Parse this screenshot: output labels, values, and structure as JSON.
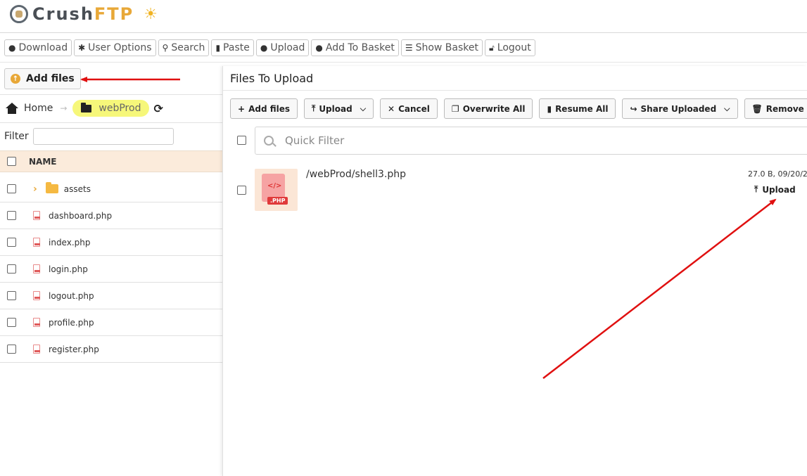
{
  "header": {
    "logo_crush": "Crush",
    "logo_ftp": "FTP",
    "logo_icon": "crushftp-logo-icon",
    "theme_icon": "sun-icon"
  },
  "toolbar": {
    "items": [
      {
        "label": "Download",
        "icon": "download-circle-icon"
      },
      {
        "label": "User Options",
        "icon": "gear-icon"
      },
      {
        "label": "Search",
        "icon": "search-icon"
      },
      {
        "label": "Paste",
        "icon": "paste-icon"
      },
      {
        "label": "Upload",
        "icon": "upload-circle-icon"
      },
      {
        "label": "Add To Basket",
        "icon": "plus-circle-icon"
      },
      {
        "label": "Show Basket",
        "icon": "list-icon"
      },
      {
        "label": "Logout",
        "icon": "lock-icon"
      }
    ]
  },
  "left": {
    "add_files_label": "Add files",
    "breadcrumb_home": "Home",
    "breadcrumb_current": "webProd",
    "filter_label": "Filter",
    "filter_value": "",
    "name_header": "NAME",
    "files": [
      {
        "name": "assets",
        "type": "folder"
      },
      {
        "name": "dashboard.php",
        "type": "file"
      },
      {
        "name": "index.php",
        "type": "file"
      },
      {
        "name": "login.php",
        "type": "file"
      },
      {
        "name": "logout.php",
        "type": "file"
      },
      {
        "name": "profile.php",
        "type": "file"
      },
      {
        "name": "register.php",
        "type": "file"
      }
    ]
  },
  "upload_panel": {
    "title": "Files To Upload",
    "buttons": {
      "add_files": "Add files",
      "upload": "Upload",
      "cancel": "Cancel",
      "overwrite_all": "Overwrite All",
      "resume_all": "Resume All",
      "share_uploaded": "Share Uploaded",
      "remove": "Remove"
    },
    "quick_filter_placeholder": "Quick Filter",
    "item": {
      "path": "/webProd/shell3.php",
      "meta": "27.0 B, 09/20/20",
      "thumb_code": "</>",
      "thumb_tag": ".PHP",
      "action": "Upload"
    }
  },
  "colors": {
    "accent": "#e8a838",
    "header_row": "#fbebdb",
    "highlight": "#f6f77a",
    "annotation": "#e01010"
  }
}
